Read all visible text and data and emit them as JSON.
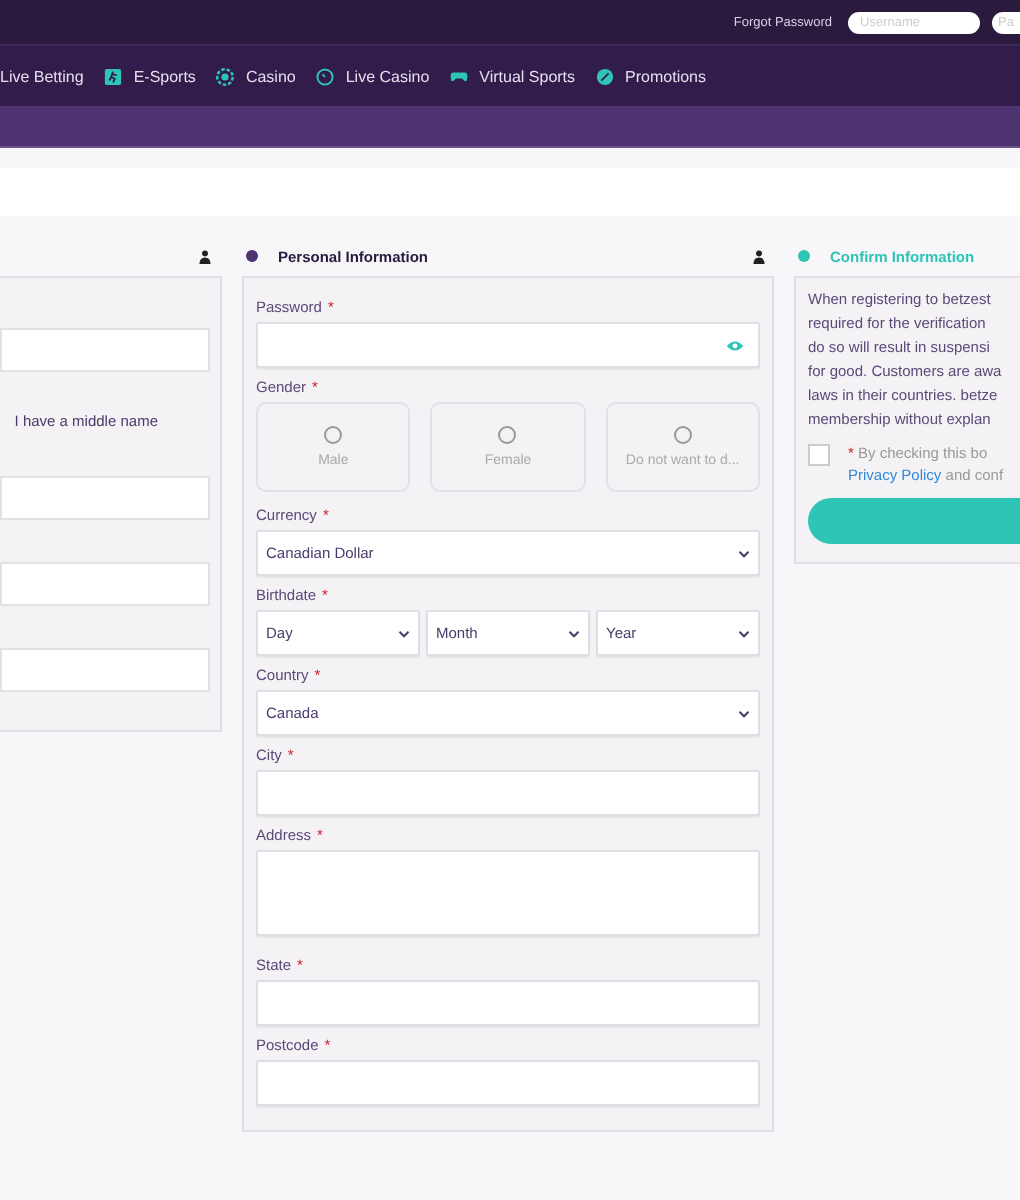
{
  "top_bar": {
    "forgot_password": "Forgot Password",
    "username": {
      "placeholder": "Username"
    },
    "password": {
      "placeholder": "Pa"
    }
  },
  "nav": [
    {
      "label": "Live Betting"
    },
    {
      "label": "E-Sports"
    },
    {
      "label": "Casino"
    },
    {
      "label": "Live Casino"
    },
    {
      "label": "Virtual Sports"
    },
    {
      "label": "Promotions"
    }
  ],
  "left_panel": {
    "middle_name": {
      "label": "I have a middle name"
    }
  },
  "personal": {
    "title": "Personal Information",
    "fields": [
      {
        "kind": "password",
        "label": "Password",
        "required_mark": "*"
      },
      {
        "kind": "gender",
        "label": "Gender",
        "required_mark": "*",
        "options": [
          {
            "label": "Male",
            "selected": false
          },
          {
            "label": "Female",
            "selected": false
          },
          {
            "label": "Do not want to d...",
            "selected": false
          }
        ]
      },
      {
        "kind": "select",
        "label": "Currency",
        "required_mark": "*",
        "value": "Canadian Dollar"
      },
      {
        "kind": "selects",
        "label": "Birthdate",
        "required_mark": "*",
        "parts": [
          "Day",
          "Month",
          "Year"
        ]
      },
      {
        "kind": "select",
        "label": "Country",
        "required_mark": "*",
        "value": "Canada"
      },
      {
        "kind": "text",
        "label": "City",
        "required_mark": "*"
      },
      {
        "kind": "textarea",
        "label": "Address",
        "required_mark": "*"
      },
      {
        "kind": "text",
        "label": "State",
        "required_mark": "*"
      },
      {
        "kind": "text",
        "label": "Postcode",
        "required_mark": "*"
      }
    ]
  },
  "confirm": {
    "title": "Confirm Information",
    "notice": [
      "When registering to betzest",
      "required for the verification",
      "do so will result in suspensi",
      "for good. Customers are awa",
      "laws in their countries. betze",
      "membership without explan"
    ],
    "agree": {
      "checked": false,
      "required_mark": "*",
      "text": "By checking this bo",
      "link": "Privacy Policy",
      "after": "and conf"
    }
  }
}
